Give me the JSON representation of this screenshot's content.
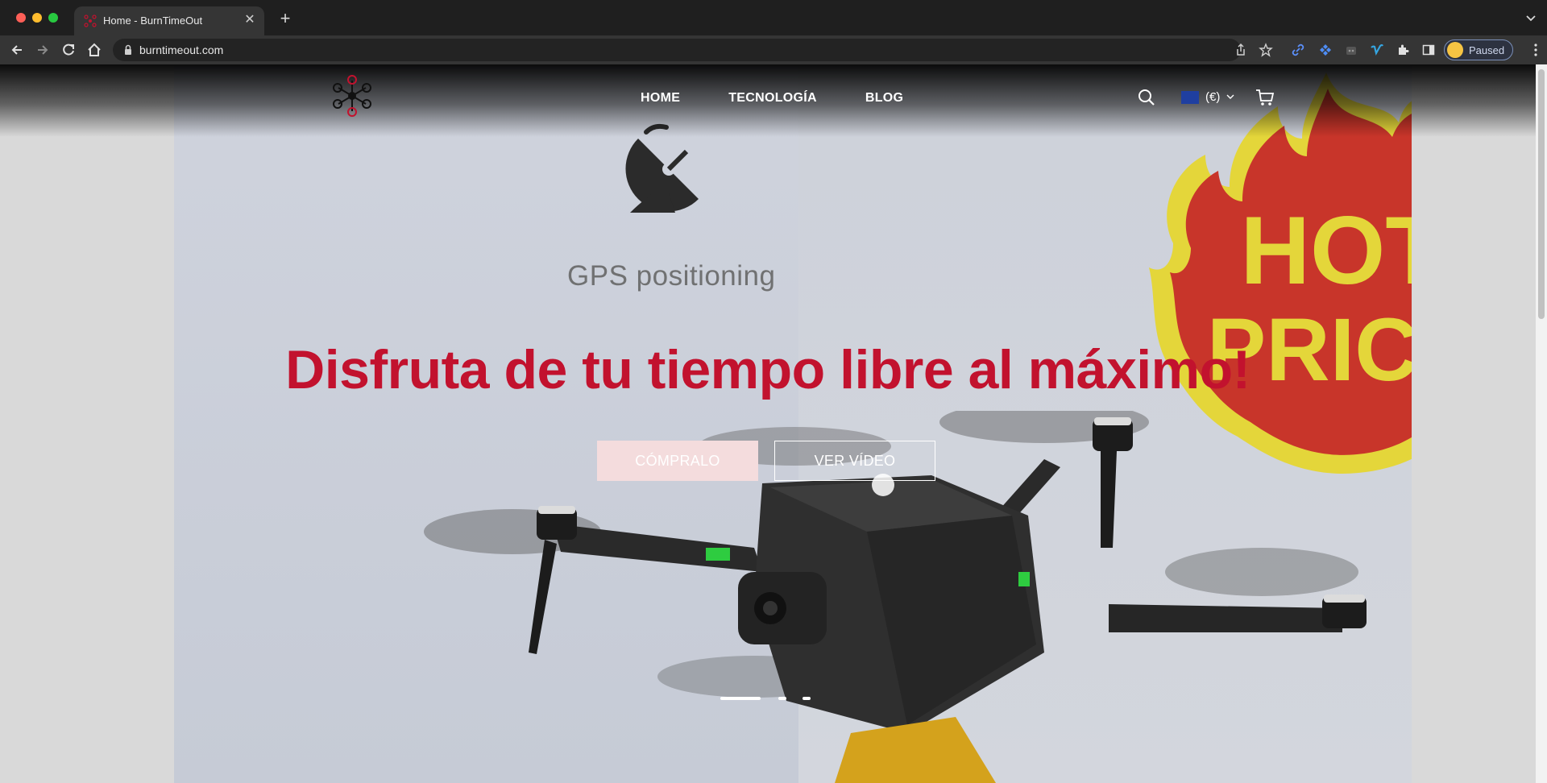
{
  "browser": {
    "tab_title": "Home - BurnTimeOut",
    "new_tab_icon": "plus-icon",
    "url": "burntimeout.com",
    "profile_label": "Paused"
  },
  "site": {
    "nav": [
      {
        "label": "HOME"
      },
      {
        "label": "TECNOLOGÍA"
      },
      {
        "label": "BLOG"
      }
    ],
    "currency_label": "(€)",
    "icons": {
      "search": "search-icon",
      "cart": "cart-icon",
      "logo": "drone-logo-icon"
    }
  },
  "hero": {
    "image_text": {
      "gps_caption": "GPS positioning",
      "badge_line1": "HOT",
      "badge_line2": "PRICE"
    },
    "headline": "Disfruta de tu tiempo libre al máximo!",
    "buy_label": "CÓMPRALO",
    "video_label": "VER VÍDEO",
    "slides": {
      "count": 3,
      "active": 1
    }
  },
  "colors": {
    "headline": "#c2122e",
    "buy_button_bg": "#f4dcdd",
    "badge_red": "#c8352a",
    "badge_yellow": "#e4d63a"
  }
}
